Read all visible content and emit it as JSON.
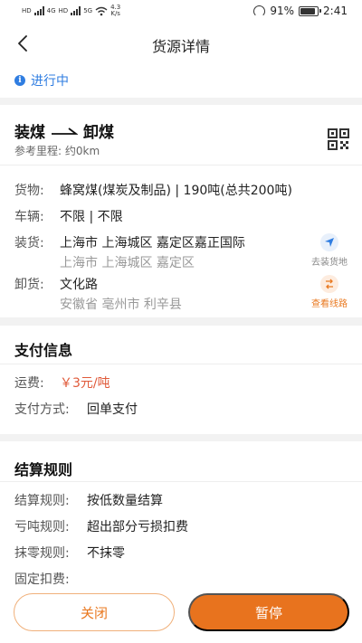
{
  "statusbar": {
    "net_left_a": "HD",
    "net_left_b": "HD",
    "net_4g": "4G",
    "net_5g": "5G",
    "speed_value": "4.3",
    "speed_unit": "K/s",
    "battery": "91%",
    "battery_level": 0.91,
    "time": "2:41"
  },
  "nav": {
    "title": "货源详情"
  },
  "status": {
    "text": "进行中",
    "color": "#2f7de1"
  },
  "route": {
    "load": "装煤",
    "unload": "卸煤",
    "distance": "参考里程: 约0km"
  },
  "details": {
    "goods_label": "货物:",
    "goods_value": "蜂窝煤(煤炭及制品) | 190吨(总共200吨)",
    "vehicle_label": "车辆:",
    "vehicle_value": "不限 | 不限",
    "load_label": "装货:",
    "load_main": "上海市 上海城区 嘉定区嘉正国际",
    "load_sub": "上海市 上海城区 嘉定区",
    "load_action": "去装货地",
    "unload_label": "卸货:",
    "unload_main": "文化路",
    "unload_sub": "安徽省 亳州市 利辛县",
    "unload_action": "查看线路"
  },
  "payment": {
    "title": "支付信息",
    "fee_label": "运费:",
    "fee_value": "￥3元/吨",
    "method_label": "支付方式:",
    "method_value": "回单支付"
  },
  "settlement": {
    "title": "结算规则",
    "rule_label": "结算规则:",
    "rule_value": "按低数量结算",
    "loss_label": "亏吨规则:",
    "loss_value": "超出部分亏损扣费",
    "round_label": "抹零规则:",
    "round_value": "不抹零",
    "fixed_label": "固定扣费:",
    "fixed_value": ""
  },
  "buttons": {
    "close": "关闭",
    "pause": "暂停"
  },
  "colors": {
    "accent": "#e8731e",
    "info": "#2f7de1",
    "price": "#e05a3a"
  }
}
